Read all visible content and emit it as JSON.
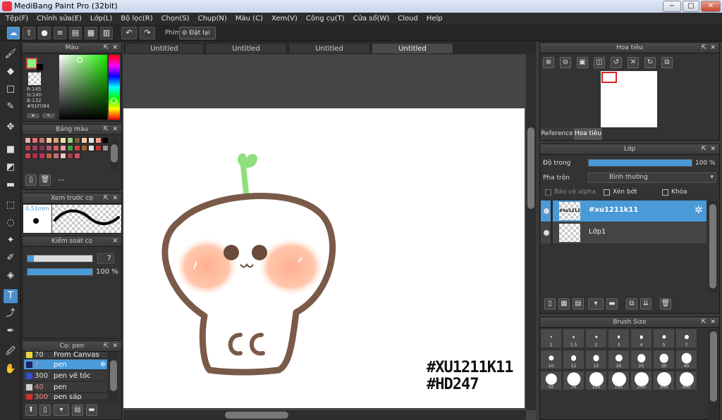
{
  "window": {
    "title": "MediBang Paint Pro (32bit)",
    "min": "−",
    "max": "□",
    "close": "✕"
  },
  "menu": [
    "Tệp(F)",
    "Chỉnh sửa(E)",
    "Lớp(L)",
    "Bộ lọc(R)",
    "Chọn(S)",
    "Chụp(N)",
    "Màu (C)",
    "Xem(V)",
    "Công cụ(T)",
    "Cửa sổ(W)",
    "Cloud",
    "Help"
  ],
  "toolbar": {
    "phim_label": "Phím",
    "reset_label": "Đặt lại"
  },
  "color_panel": {
    "title": "Màu",
    "r": "R:145",
    "g": "G:240",
    "b": "B:132",
    "hex": "#91F084",
    "fg_color": "#91f084"
  },
  "palette_panel": {
    "title": "Bảng màu",
    "dash": "---",
    "colors": [
      "#f0b0b0",
      "#e07070",
      "#c87070",
      "#f0c8a0",
      "#e0a070",
      "#f0e0b0",
      "#a0d080",
      "#806040",
      "#f4c8a8",
      "#e0e0e0",
      "#f09890",
      "#000000",
      "#c04040",
      "#a04060",
      "#8a3050",
      "#a06070",
      "#d06060",
      "#f0a0a0",
      "#40a040",
      "#d04040",
      "#a06030",
      "#e0e0e0",
      "#c03030",
      "#a09090",
      "#d04050",
      "#b03040",
      "#c03060",
      "#c06040",
      "#c07080",
      "#f0c0c0",
      "#a04040",
      "#d05060"
    ]
  },
  "brush_preview": {
    "title": "Xem trước cọ",
    "size": "0.51mm"
  },
  "brush_control": {
    "title": "Kiểm soát cọ",
    "size_value": "7",
    "opacity_value": "100 %",
    "size_fraction": 0.1,
    "opacity_fraction": 1.0
  },
  "brush_list": {
    "title": "Cọ: pen",
    "items": [
      {
        "num": "70",
        "name": "From Canvas",
        "color": "#e8d040"
      },
      {
        "num": "7",
        "name": "pen",
        "color": "#202060",
        "selected": true
      },
      {
        "num": "300",
        "name": "pen vẽ tóc",
        "color": "#3050d0"
      },
      {
        "num": "40",
        "name": "pen",
        "color": "#d0d0d0"
      },
      {
        "num": "300",
        "name": "pen sáp",
        "color": "#d03030"
      }
    ]
  },
  "tabs": [
    "Untitled",
    "Untitled",
    "Untitled",
    "Untitled"
  ],
  "canvas": {
    "line1": "#XU1211K11",
    "line2": "#HD247"
  },
  "navigator": {
    "title": "Hoa tiêu",
    "tab_reference": "Reference",
    "tab_navigator": "Hoa tiêu"
  },
  "layer_panel": {
    "title": "Lớp",
    "opacity_label": "Độ trong",
    "opacity_value": "100 %",
    "opacity_fraction": 1.0,
    "blend_label": "Pha trộn",
    "blend_value": "Bình thường",
    "protect_alpha": "Bảo vệ alpha",
    "clipping": "Xén bớt",
    "lock": "Khóa",
    "layers": [
      {
        "name": "#xu1211k11",
        "thumb": "#xu1211k11",
        "selected": true
      },
      {
        "name": "Lớp1",
        "selected": false
      }
    ]
  },
  "brush_size": {
    "title": "Brush Size",
    "sizes": [
      "1",
      "1.5",
      "2",
      "3",
      "4",
      "5",
      "7",
      "10",
      "12",
      "15",
      "20",
      "25",
      "30",
      "40",
      "50",
      "70",
      "100",
      "150",
      "200",
      "300",
      "400"
    ]
  }
}
